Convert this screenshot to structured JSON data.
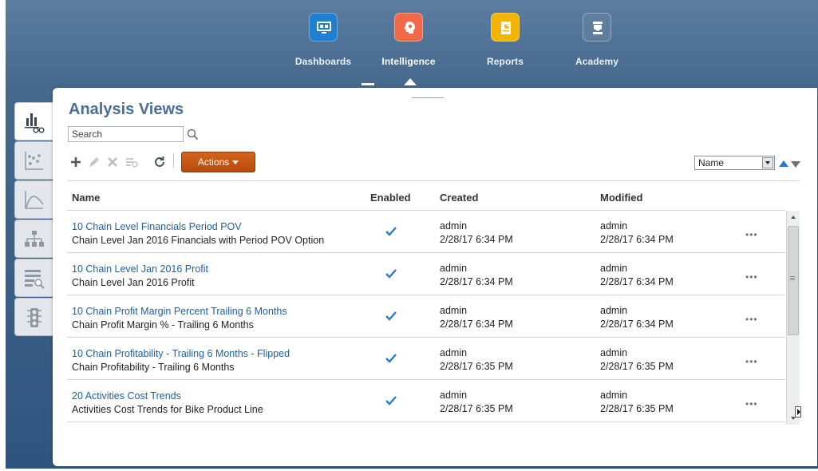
{
  "nav": {
    "items": [
      {
        "label": "Dashboards",
        "icon": "dashboard-monitor-icon",
        "color": "#1f7fd1"
      },
      {
        "label": "Intelligence",
        "icon": "intelligence-head-icon",
        "color": "#f06a4a"
      },
      {
        "label": "Reports",
        "icon": "reports-book-icon",
        "color": "#f2b400"
      },
      {
        "label": "Academy",
        "icon": "academy-graduate-icon",
        "color": "#5f7d9f"
      }
    ],
    "active": "Intelligence"
  },
  "page": {
    "title": "Analysis Views"
  },
  "search": {
    "placeholder": "Search"
  },
  "toolbar": {
    "actions_label": "Actions",
    "sort_selected": "Name"
  },
  "table": {
    "headers": {
      "name": "Name",
      "enabled": "Enabled",
      "created": "Created",
      "modified": "Modified"
    },
    "rows": [
      {
        "name": "10 Chain Level Financials Period POV",
        "description": "Chain Level Jan 2016 Financials with Period POV Option",
        "enabled": true,
        "created_by": "admin",
        "created_at": "2/28/17 6:34 PM",
        "modified_by": "admin",
        "modified_at": "2/28/17 6:34 PM",
        "more": "•••"
      },
      {
        "name": "10 Chain Level Jan 2016 Profit",
        "description": "Chain Level Jan 2016 Profit",
        "enabled": true,
        "created_by": "admin",
        "created_at": "2/28/17 6:34 PM",
        "modified_by": "admin",
        "modified_at": "2/28/17 6:34 PM",
        "more": "•••"
      },
      {
        "name": "10 Chain Profit Margin Percent Trailing 6 Months",
        "description": "Chain Profit Margin % - Trailing 6 Months",
        "enabled": true,
        "created_by": "admin",
        "created_at": "2/28/17 6:34 PM",
        "modified_by": "admin",
        "modified_at": "2/28/17 6:34 PM",
        "more": "•••"
      },
      {
        "name": "10 Chain Profitability - Trailing 6 Months - Flipped",
        "description": "Chain Profitability - Trailing 6 Months",
        "enabled": true,
        "created_by": "admin",
        "created_at": "2/28/17 6:35 PM",
        "modified_by": "admin",
        "modified_at": "2/28/17 6:35 PM",
        "more": "•••"
      },
      {
        "name": "20 Activities Cost Trends",
        "description": "Activities Cost Trends for Bike Product Line",
        "enabled": true,
        "created_by": "admin",
        "created_at": "2/28/17 6:35 PM",
        "modified_by": "admin",
        "modified_at": "2/28/17 6:35 PM",
        "more": "•••"
      }
    ]
  },
  "sidetabs": [
    "analysis-views-icon",
    "scatter-analysis-icon",
    "trend-curve-icon",
    "hierarchy-icon",
    "report-search-icon",
    "traffic-light-icon"
  ]
}
